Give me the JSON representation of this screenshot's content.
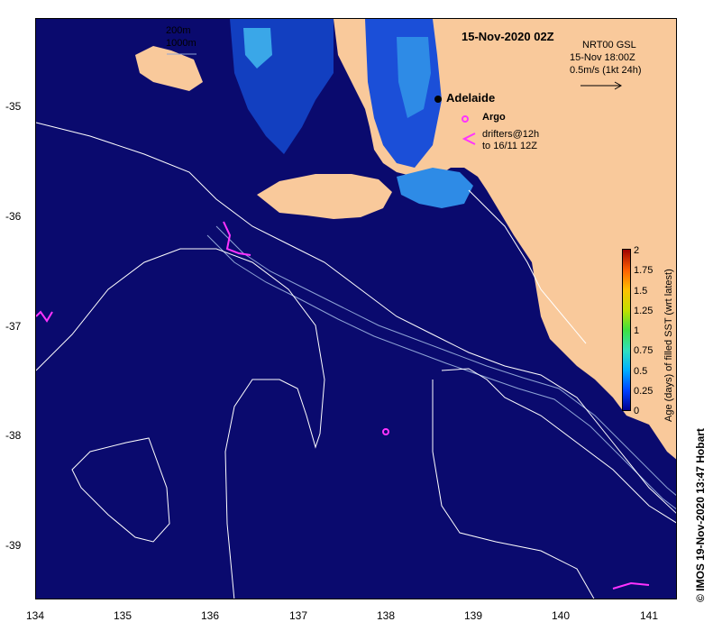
{
  "title": "15-Nov-2020 02Z",
  "product": {
    "line1": "NRT00 GSL",
    "line2": "15-Nov 18:00Z",
    "line3": "0.5m/s (1kt 24h)"
  },
  "isobath_legend": [
    "200m",
    "1000m"
  ],
  "places": {
    "adelaide": "Adelaide"
  },
  "legend": {
    "argo": "Argo",
    "drifters_line1": "drifters@12h",
    "drifters_line2": "to 16/11 12Z"
  },
  "axes": {
    "x_ticks": [
      "134",
      "135",
      "136",
      "137",
      "138",
      "139",
      "140",
      "141"
    ],
    "y_ticks": [
      "-35",
      "-36",
      "-37",
      "-38",
      "-39"
    ]
  },
  "colorbar": {
    "label": "Age (days) of filled SST (wrt latest)",
    "ticks": [
      "2",
      "1.75",
      "1.5",
      "1.25",
      "1",
      "0.75",
      "0.5",
      "0.25",
      "0"
    ],
    "min": 0,
    "max": 2
  },
  "credit": "© IMOS 19-Nov-2020 13:47 Hobart",
  "colors": {
    "ocean": "#0a0a6e",
    "land": "#f9c99b",
    "marker": "#ff33ff",
    "contour": "#ffffff"
  }
}
